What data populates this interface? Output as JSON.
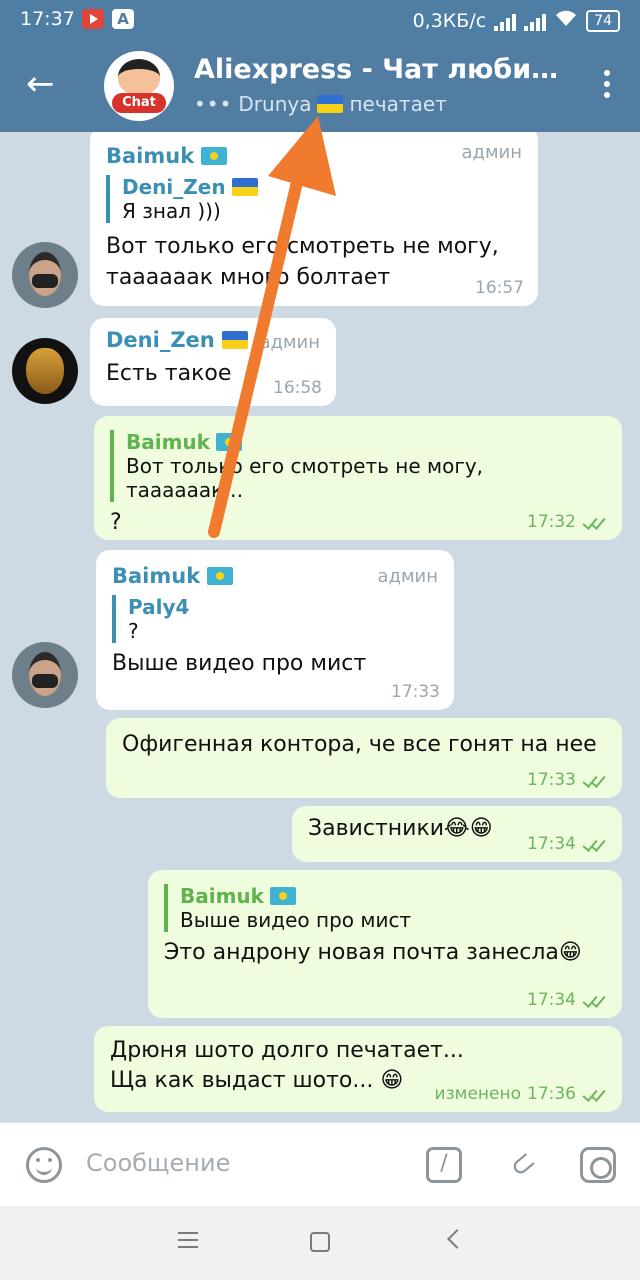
{
  "status_bar": {
    "time": "17:37",
    "network_speed": "0,3КБ/с",
    "battery": "74"
  },
  "header": {
    "title": "Aliexpress - Чат любител…",
    "typing_user": "Drunya",
    "typing_status": "печатает",
    "avatar_label": "Chat"
  },
  "messages": [
    {
      "sender": "Baimuk",
      "badge": "админ",
      "reply_name": "Deni_Zen",
      "reply_text": "Я знал )))",
      "text": "Вот только его смотреть не могу, таааааак много болтает",
      "time": "16:57"
    },
    {
      "sender": "Deni_Zen",
      "badge": "админ",
      "text": "Есть такое",
      "time": "16:58"
    },
    {
      "reply_name": "Baimuk",
      "reply_text": "Вот только его смотреть не могу, таааааак…",
      "text": "?",
      "time": "17:32"
    },
    {
      "sender": "Baimuk",
      "badge": "админ",
      "reply_name": "Paly4",
      "reply_text": "?",
      "text": "Выше видео про мист",
      "time": "17:33"
    },
    {
      "text": "Офигенная контора, че все гонят на нее",
      "time": "17:33"
    },
    {
      "text": "Завистники😂😁",
      "time": "17:34"
    },
    {
      "reply_name": "Baimuk",
      "reply_text": "Выше видео про мист",
      "text": "Это андрону новая почта занесла😁",
      "time": "17:34"
    },
    {
      "text_line1": "Дрюня шото долго печатает...",
      "text_line2": "Ща как выдаст шото... 😁",
      "edited": "изменено",
      "time": "17:36"
    }
  ],
  "input": {
    "placeholder": "Сообщение",
    "command_symbol": "/"
  },
  "colors": {
    "header": "#517da2",
    "outgoing_bubble": "#effdde",
    "accent_name": "#3a8fb3",
    "arrow": "#f07a2e"
  }
}
